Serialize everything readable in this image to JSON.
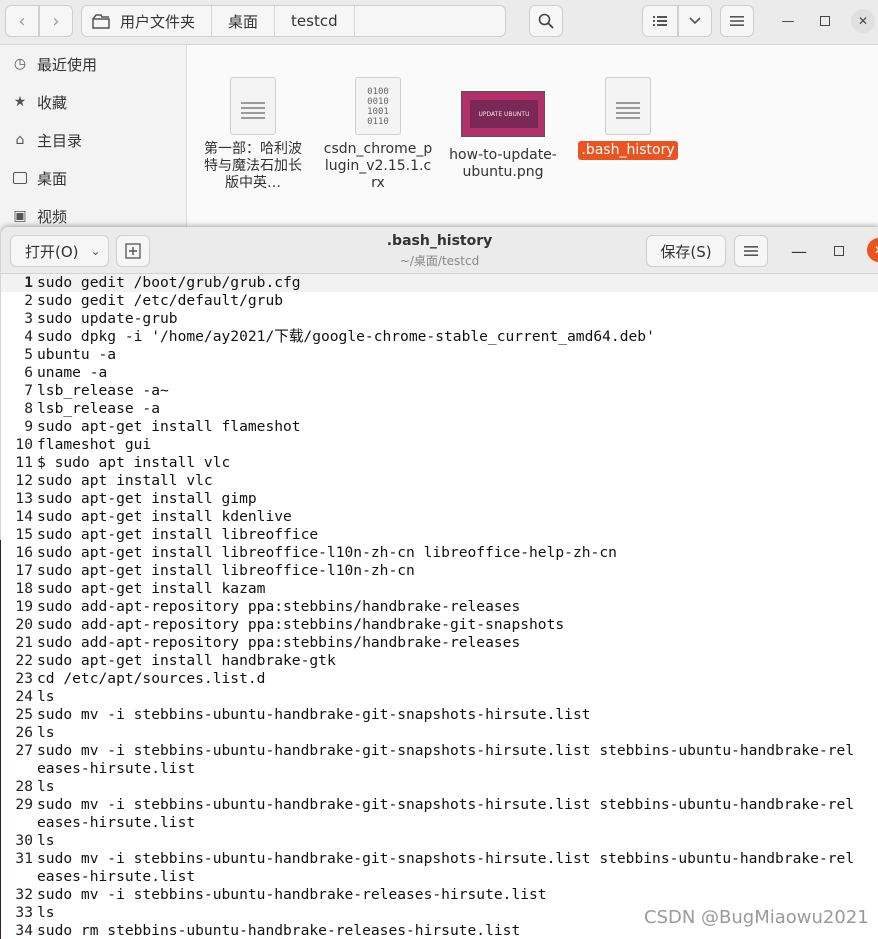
{
  "file_manager": {
    "path": [
      "用户文件夹",
      "桌面",
      "testcd"
    ],
    "sidebar": [
      "最近使用",
      "收藏",
      "主目录",
      "桌面",
      "视频"
    ],
    "files": [
      {
        "name": "第一部：哈利波特与魔法石加长版中英…",
        "icon": "document-icon"
      },
      {
        "name": "csdn_chrome_plugin_v2.15.1.crx",
        "icon": "binary-icon"
      },
      {
        "name": "how-to-update-ubuntu.png",
        "icon": "image-thumbnail",
        "thumb_text": "UPDATE UBUNTU"
      },
      {
        "name": ".bash_history",
        "icon": "document-icon",
        "selected": true
      }
    ]
  },
  "editor": {
    "open_label": "打开(O)",
    "title": ".bash_history",
    "subtitle": "~/桌面/testcd",
    "save_label": "保存(S)",
    "accent": "#e95420",
    "lines": [
      {
        "n": "1",
        "t": "sudo gedit /boot/grub/grub.cfg"
      },
      {
        "n": "2",
        "t": "sudo gedit /etc/default/grub"
      },
      {
        "n": "3",
        "t": "sudo update-grub"
      },
      {
        "n": "4",
        "t": "sudo dpkg -i '/home/ay2021/下载/google-chrome-stable_current_amd64.deb'"
      },
      {
        "n": "5",
        "t": "ubuntu -a"
      },
      {
        "n": "6",
        "t": "uname -a"
      },
      {
        "n": "7",
        "t": "lsb_release -a~"
      },
      {
        "n": "8",
        "t": "lsb_release -a"
      },
      {
        "n": "9",
        "t": "sudo apt-get install flameshot"
      },
      {
        "n": "10",
        "t": "flameshot gui"
      },
      {
        "n": "11",
        "t": "$ sudo apt install vlc"
      },
      {
        "n": "12",
        "t": "sudo apt install vlc"
      },
      {
        "n": "13",
        "t": "sudo apt-get install gimp"
      },
      {
        "n": "14",
        "t": "sudo apt-get install kdenlive"
      },
      {
        "n": "15",
        "t": "sudo apt-get install libreoffice"
      },
      {
        "n": "16",
        "t": "sudo apt-get install libreoffice-l10n-zh-cn libreoffice-help-zh-cn"
      },
      {
        "n": "17",
        "t": "sudo apt-get install libreoffice-l10n-zh-cn"
      },
      {
        "n": "18",
        "t": "sudo apt-get install kazam"
      },
      {
        "n": "19",
        "t": "sudo add-apt-repository ppa:stebbins/handbrake-releases"
      },
      {
        "n": "20",
        "t": "sudo add-apt-repository ppa:stebbins/handbrake-git-snapshots"
      },
      {
        "n": "21",
        "t": "sudo add-apt-repository ppa:stebbins/handbrake-releases"
      },
      {
        "n": "22",
        "t": "sudo apt-get install handbrake-gtk"
      },
      {
        "n": "23",
        "t": "cd /etc/apt/sources.list.d"
      },
      {
        "n": "24",
        "t": "ls"
      },
      {
        "n": "25",
        "t": "sudo mv -i stebbins-ubuntu-handbrake-git-snapshots-hirsute.list"
      },
      {
        "n": "26",
        "t": "ls"
      },
      {
        "n": "27",
        "t": "sudo mv -i stebbins-ubuntu-handbrake-git-snapshots-hirsute.list stebbins-ubuntu-handbrake-releases-hirsute.list"
      },
      {
        "n": "28",
        "t": "ls"
      },
      {
        "n": "29",
        "t": "sudo mv -i stebbins-ubuntu-handbrake-git-snapshots-hirsute.list stebbins-ubuntu-handbrake-releases-hirsute.list"
      },
      {
        "n": "30",
        "t": "ls"
      },
      {
        "n": "31",
        "t": "sudo mv -i stebbins-ubuntu-handbrake-git-snapshots-hirsute.list stebbins-ubuntu-handbrake-releases-hirsute.list"
      },
      {
        "n": "32",
        "t": "sudo mv -i stebbins-ubuntu-handbrake-releases-hirsute.list"
      },
      {
        "n": "33",
        "t": "ls"
      },
      {
        "n": "34",
        "t": "sudo rm stebbins-ubuntu-handbrake-releases-hirsute.list"
      }
    ]
  },
  "watermark": "CSDN @BugMiaowu2021"
}
